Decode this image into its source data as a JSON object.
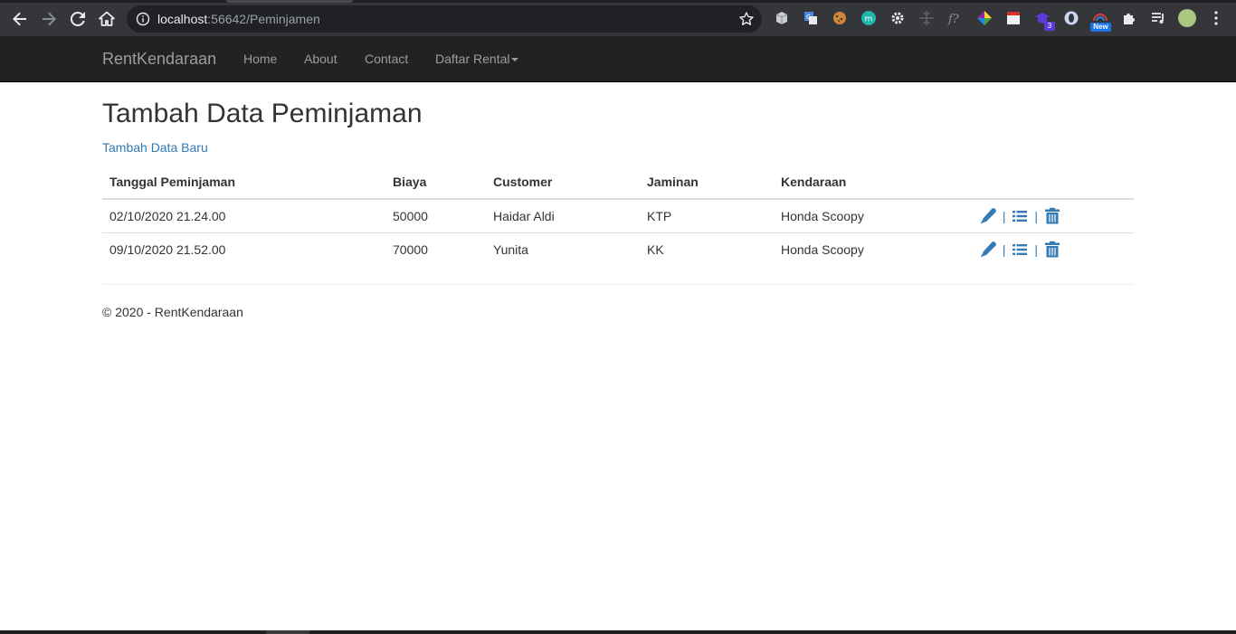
{
  "browser": {
    "url_host": "localhost",
    "url_path": ":56642/Peminjamen",
    "badge_count": "3",
    "badge_new": "New"
  },
  "navbar": {
    "brand": "RentKendaraan",
    "links": [
      "Home",
      "About",
      "Contact",
      "Daftar Rental"
    ]
  },
  "page": {
    "title": "Tambah Data Peminjaman",
    "create_link": "Tambah Data Baru"
  },
  "table": {
    "headers": [
      "Tanggal Peminjaman",
      "Biaya",
      "Customer",
      "Jaminan",
      "Kendaraan"
    ],
    "rows": [
      [
        "02/10/2020 21.24.00",
        "50000",
        "Haidar Aldi",
        "KTP",
        "Honda Scoopy"
      ],
      [
        "09/10/2020 21.52.00",
        "70000",
        "Yunita",
        "KK",
        "Honda Scoopy"
      ]
    ],
    "separator": "|",
    "action_icons": [
      "edit-icon",
      "details-icon",
      "delete-icon"
    ]
  },
  "footer": {
    "text": "© 2020 - RentKendaraan"
  },
  "colors": {
    "navbar_bg": "#222222",
    "link": "#337ab7",
    "chrome_bg": "#35363a"
  }
}
